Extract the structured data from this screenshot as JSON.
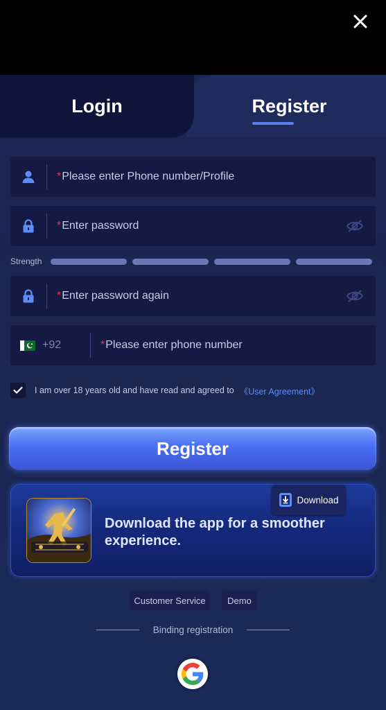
{
  "header": {
    "close_icon": "close-icon"
  },
  "tabs": {
    "login_label": "Login",
    "register_label": "Register",
    "active": "register"
  },
  "form": {
    "username": {
      "required_mark": "*",
      "placeholder": "Please enter Phone number/Profile",
      "icon": "user-icon"
    },
    "password": {
      "required_mark": "*",
      "placeholder": "Enter password",
      "icon": "lock-icon",
      "toggle_icon": "eye-off-icon"
    },
    "strength": {
      "label": "Strength",
      "segments": 4
    },
    "password_again": {
      "required_mark": "*",
      "placeholder": "Enter password again",
      "icon": "lock-icon",
      "toggle_icon": "eye-off-icon"
    },
    "phone": {
      "country_flag": "pakistan-flag-icon",
      "country_code": "+92",
      "required_mark": "*",
      "placeholder": "Please enter phone number"
    },
    "agreement": {
      "checked": true,
      "text": "I am over 18 years old and have read and agreed to",
      "link_text": "《User Agreement》"
    },
    "submit_label": "Register"
  },
  "download_card": {
    "message": "Download the app for a smoother experience.",
    "button_label": "Download",
    "app_icon": "app-logo-icon"
  },
  "footer": {
    "customer_service_label": "Customer Service",
    "demo_label": "Demo",
    "binding_label": "Binding registration",
    "google_icon": "google-icon"
  },
  "colors": {
    "background": "#1b2550",
    "field_bg": "#141a44",
    "accent": "#4a6ef0",
    "required": "#e8394a",
    "link": "#5b8cf7"
  }
}
